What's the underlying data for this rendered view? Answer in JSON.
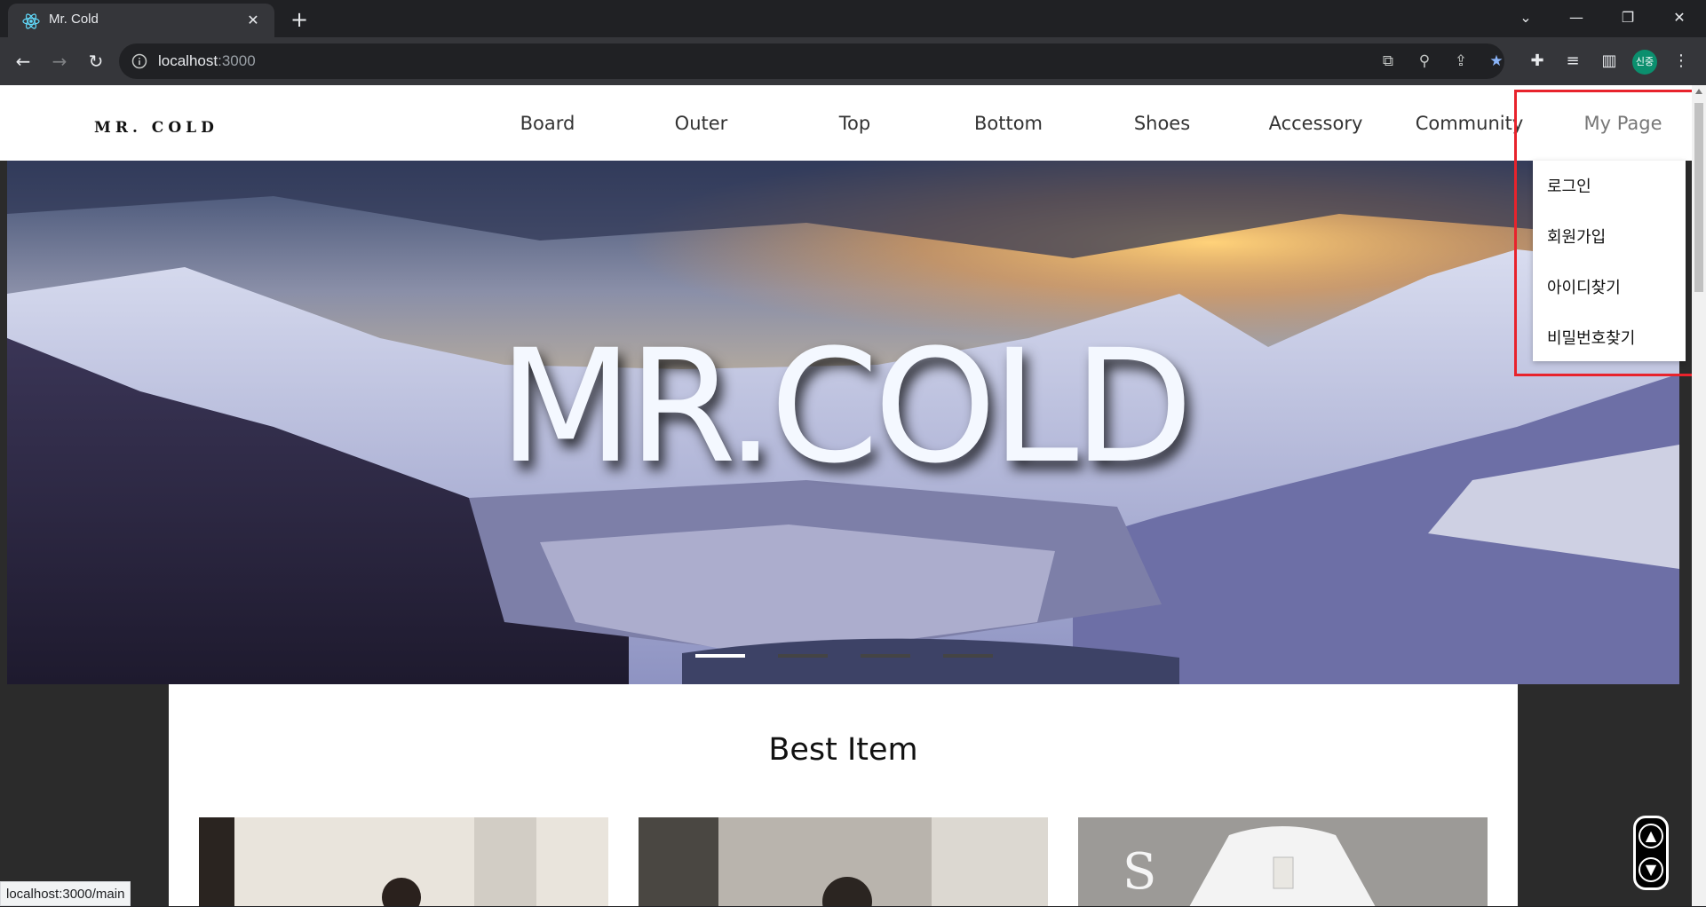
{
  "browser": {
    "tab_title": "Mr. Cold",
    "url_host": "localhost",
    "url_port": ":3000",
    "profile_label": "신중",
    "status_url": "localhost:3000/main"
  },
  "site": {
    "logo": "MR. COLD",
    "nav": [
      "Board",
      "Outer",
      "Top",
      "Bottom",
      "Shoes",
      "Accessory",
      "Community",
      "My Page"
    ],
    "hero_title": "MR.COLD",
    "slides": 4,
    "active_slide": 1,
    "mypage_menu": [
      "로그인",
      "회원가입",
      "아이디찾기",
      "비밀번호찾기"
    ],
    "section_title": "Best Item",
    "product_count": 3
  },
  "colors": {
    "highlight": "#e8232c",
    "chrome_bg": "#202124",
    "toolbar_bg": "#35363a"
  },
  "icons": [
    "react-favicon",
    "close-icon",
    "plus-icon",
    "back-icon",
    "forward-icon",
    "reload-icon",
    "info-icon",
    "open-in-app-icon",
    "zoom-icon",
    "share-icon",
    "star-icon",
    "puzzle-icon",
    "media-icon",
    "sidepanel-icon",
    "menu-icon",
    "scroll-up-icon",
    "scroll-down-icon"
  ]
}
